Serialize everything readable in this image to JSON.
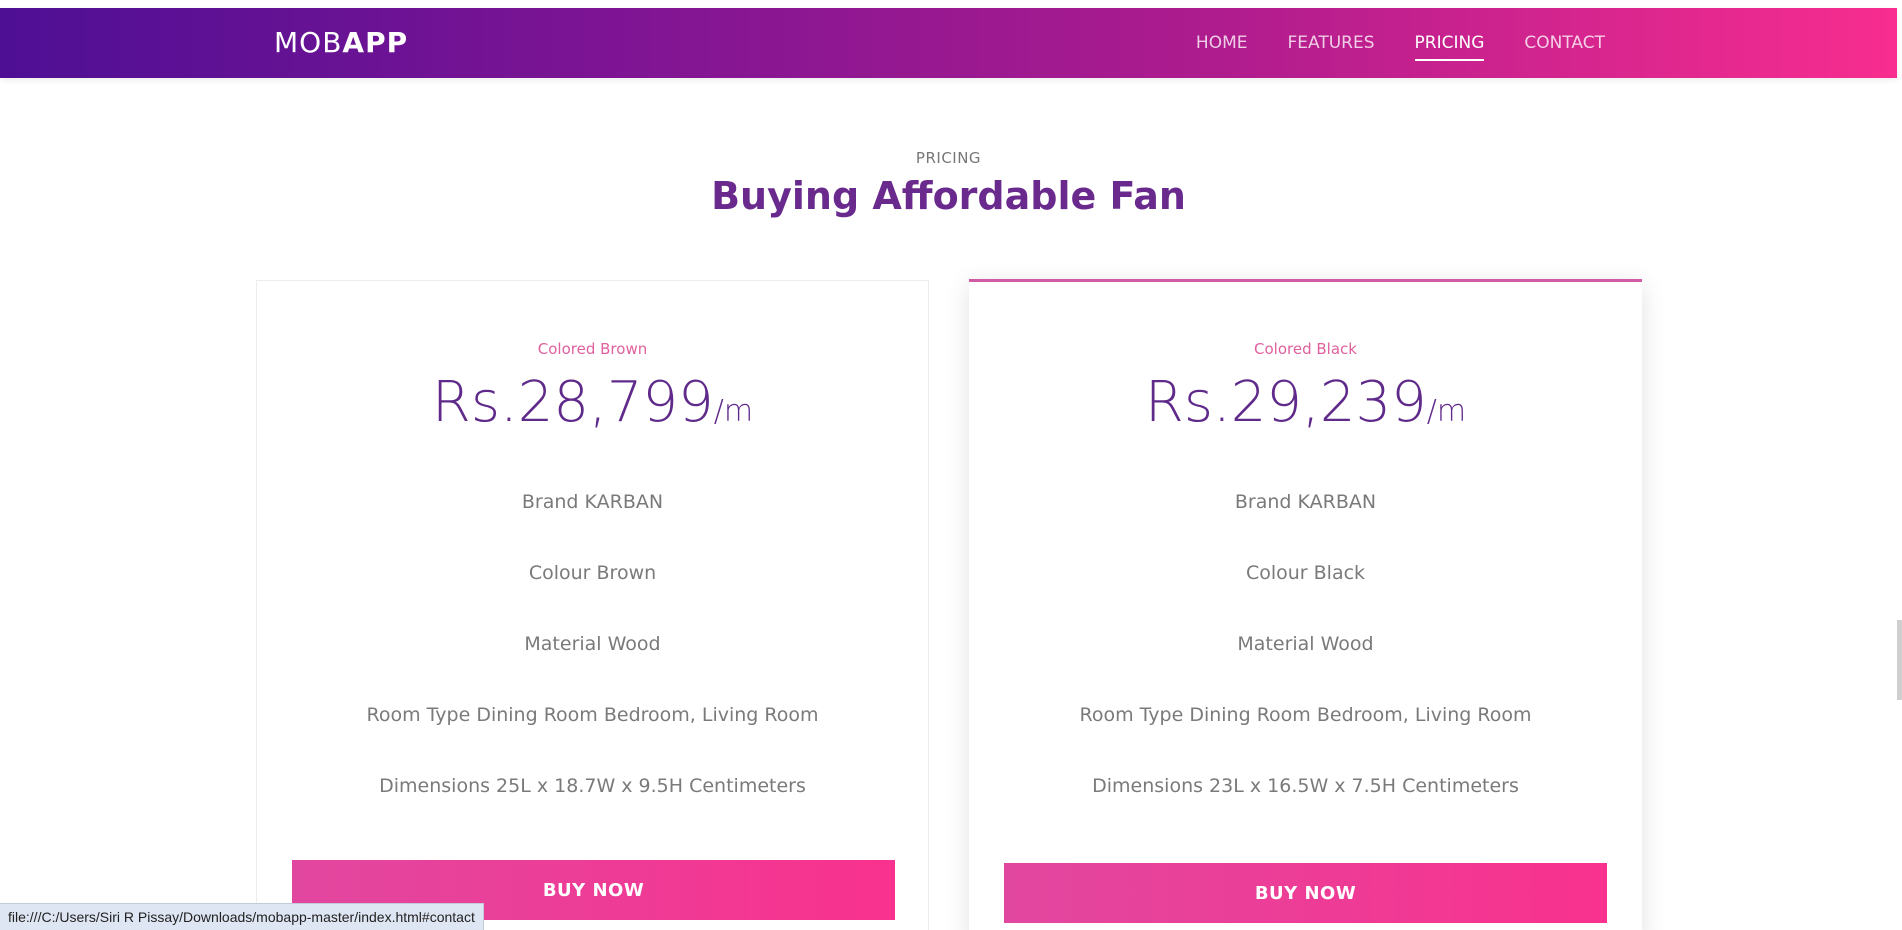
{
  "navbar": {
    "brand_light": "MOB",
    "brand_bold": "APP",
    "links": [
      "HOME",
      "FEATURES",
      "PRICING",
      "CONTACT"
    ],
    "active": "PRICING"
  },
  "section": {
    "tag": "PRICING",
    "title": "Buying Affordable Fan"
  },
  "cards": [
    {
      "plan": "Colored Brown",
      "price": "Rs.28,799",
      "unit": "/m",
      "features": [
        "Brand KARBAN",
        "Colour Brown",
        "Material Wood",
        "Room Type Dining Room Bedroom, Living Room",
        "Dimensions 25L x 18.7W x 9.5H Centimeters"
      ],
      "button": "BUY NOW"
    },
    {
      "plan": "Colored Black",
      "price": "Rs.29,239",
      "unit": "/m",
      "features": [
        "Brand KARBAN",
        "Colour Black",
        "Material Wood",
        "Room Type Dining Room Bedroom, Living Room",
        "Dimensions 23L x 16.5W x 7.5H Centimeters"
      ],
      "button": "BUY NOW"
    }
  ],
  "statusbar": {
    "url": "file:///C:/Users/Siri R Pissay/Downloads/mobapp-master/index.html#contact"
  },
  "colors": {
    "gradient_start": "#4e0f95",
    "gradient_end": "#f82d8f",
    "title": "#6a2a8d",
    "accent": "#e0609d",
    "button": "#f8328e"
  }
}
